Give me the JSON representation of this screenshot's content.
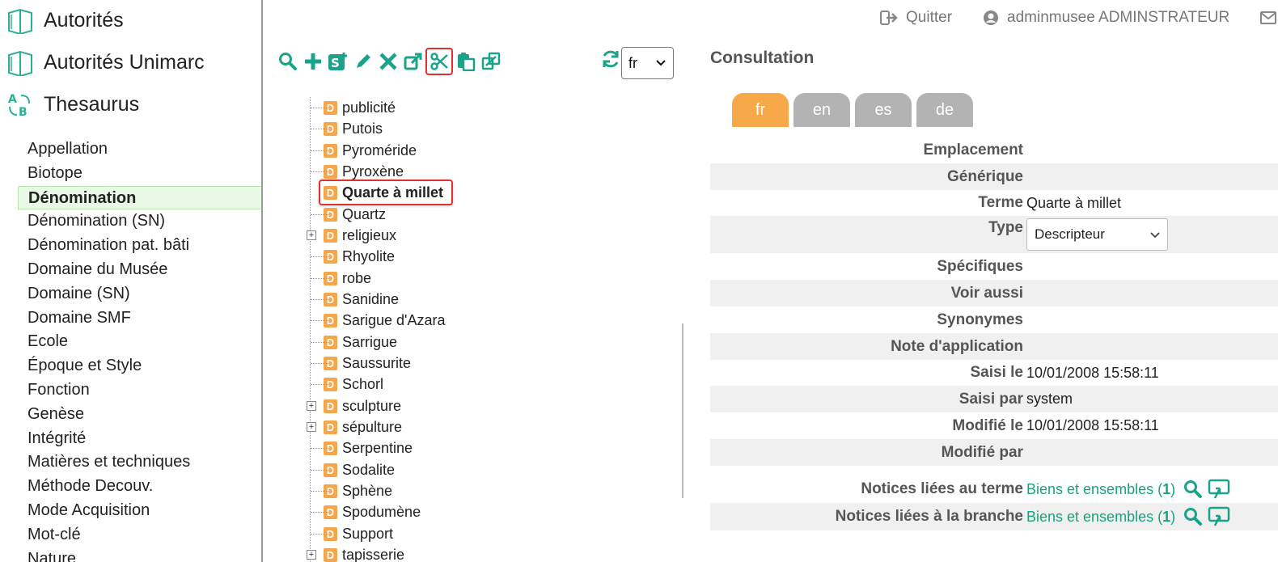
{
  "sidebar": {
    "modules": [
      {
        "label": "Autorités",
        "icon": "book-icon"
      },
      {
        "label": "Autorités Unimarc",
        "icon": "book-icon"
      },
      {
        "label": "Thesaurus",
        "icon": "thesaurus-icon"
      }
    ],
    "thesaurus_items": [
      "Appellation",
      "Biotope",
      "Dénomination",
      "Dénomination (SN)",
      "Dénomination pat. bâti",
      "Domaine du Musée",
      "Domaine (SN)",
      "Domaine SMF",
      "Ecole",
      "Époque et Style",
      "Fonction",
      "Genèse",
      "Intégrité",
      "Matières et techniques",
      "Méthode Decouv.",
      "Mode Acquisition",
      "Mot-clé",
      "Nature"
    ],
    "active_item": "Dénomination"
  },
  "topbar": {
    "quit_label": "Quitter",
    "user_label": "adminmusee ADMINSTRATEUR"
  },
  "toolbar": {
    "tools": [
      "search-icon",
      "add-icon",
      "add-specific-icon",
      "edit-icon",
      "delete-icon",
      "open-external-icon",
      "cut-icon",
      "paste-icon",
      "move-icon"
    ],
    "selected_tool": "cut-icon",
    "language_select": "fr"
  },
  "tree": {
    "nodes": [
      {
        "label": "publicité",
        "expandable": false
      },
      {
        "label": "Putois",
        "expandable": false
      },
      {
        "label": "Pyroméride",
        "expandable": false
      },
      {
        "label": "Pyroxène",
        "expandable": false
      },
      {
        "label": "Quarte à millet",
        "expandable": false,
        "selected": true
      },
      {
        "label": "Quartz",
        "expandable": false
      },
      {
        "label": "religieux",
        "expandable": true
      },
      {
        "label": "Rhyolite",
        "expandable": false
      },
      {
        "label": "robe",
        "expandable": false
      },
      {
        "label": "Sanidine",
        "expandable": false
      },
      {
        "label": "Sarigue d'Azara",
        "expandable": false
      },
      {
        "label": "Sarrigue",
        "expandable": false
      },
      {
        "label": "Saussurite",
        "expandable": false
      },
      {
        "label": "Schorl",
        "expandable": false
      },
      {
        "label": "sculpture",
        "expandable": true
      },
      {
        "label": "sépulture",
        "expandable": true
      },
      {
        "label": "Serpentine",
        "expandable": false
      },
      {
        "label": "Sodalite",
        "expandable": false
      },
      {
        "label": "Sphène",
        "expandable": false
      },
      {
        "label": "Spodumène",
        "expandable": false
      },
      {
        "label": "Support",
        "expandable": false
      },
      {
        "label": "tapisserie",
        "expandable": true
      }
    ],
    "badge": "D"
  },
  "consultation": {
    "title": "Consultation",
    "lang_tabs": [
      "fr",
      "en",
      "es",
      "de"
    ],
    "active_tab": "fr",
    "fields": {
      "emplacement": {
        "label": "Emplacement",
        "value": ""
      },
      "generique": {
        "label": "Générique",
        "value": ""
      },
      "terme": {
        "label": "Terme",
        "value": "Quarte à millet"
      },
      "type": {
        "label": "Type",
        "value": "Descripteur"
      },
      "specifiques": {
        "label": "Spécifiques",
        "value": ""
      },
      "voir_aussi": {
        "label": "Voir aussi",
        "value": ""
      },
      "synonymes": {
        "label": "Synonymes",
        "value": ""
      },
      "note": {
        "label": "Note d'application",
        "value": ""
      },
      "saisi_le": {
        "label": "Saisi le",
        "value": "10/01/2008 15:58:11"
      },
      "saisi_par": {
        "label": "Saisi par",
        "value": "system"
      },
      "modifie_le": {
        "label": "Modifié le",
        "value": "10/01/2008 15:58:11"
      },
      "modifie_par": {
        "label": "Modifié par",
        "value": ""
      },
      "notices_terme": {
        "label": "Notices liées au terme",
        "link_text": "Biens et ensembles (",
        "count": "1",
        "close": ")"
      },
      "notices_branche": {
        "label": "Notices liées à la branche",
        "link_text": "Biens et ensembles (",
        "count": "1",
        "close": ")"
      }
    }
  },
  "colors": {
    "accent_orange": "#f7a94a",
    "tab_grey": "#b3b3b3",
    "link_green": "#16a37f",
    "active_green_bg": "#e8f9e5",
    "selection_red": "#e03030"
  }
}
